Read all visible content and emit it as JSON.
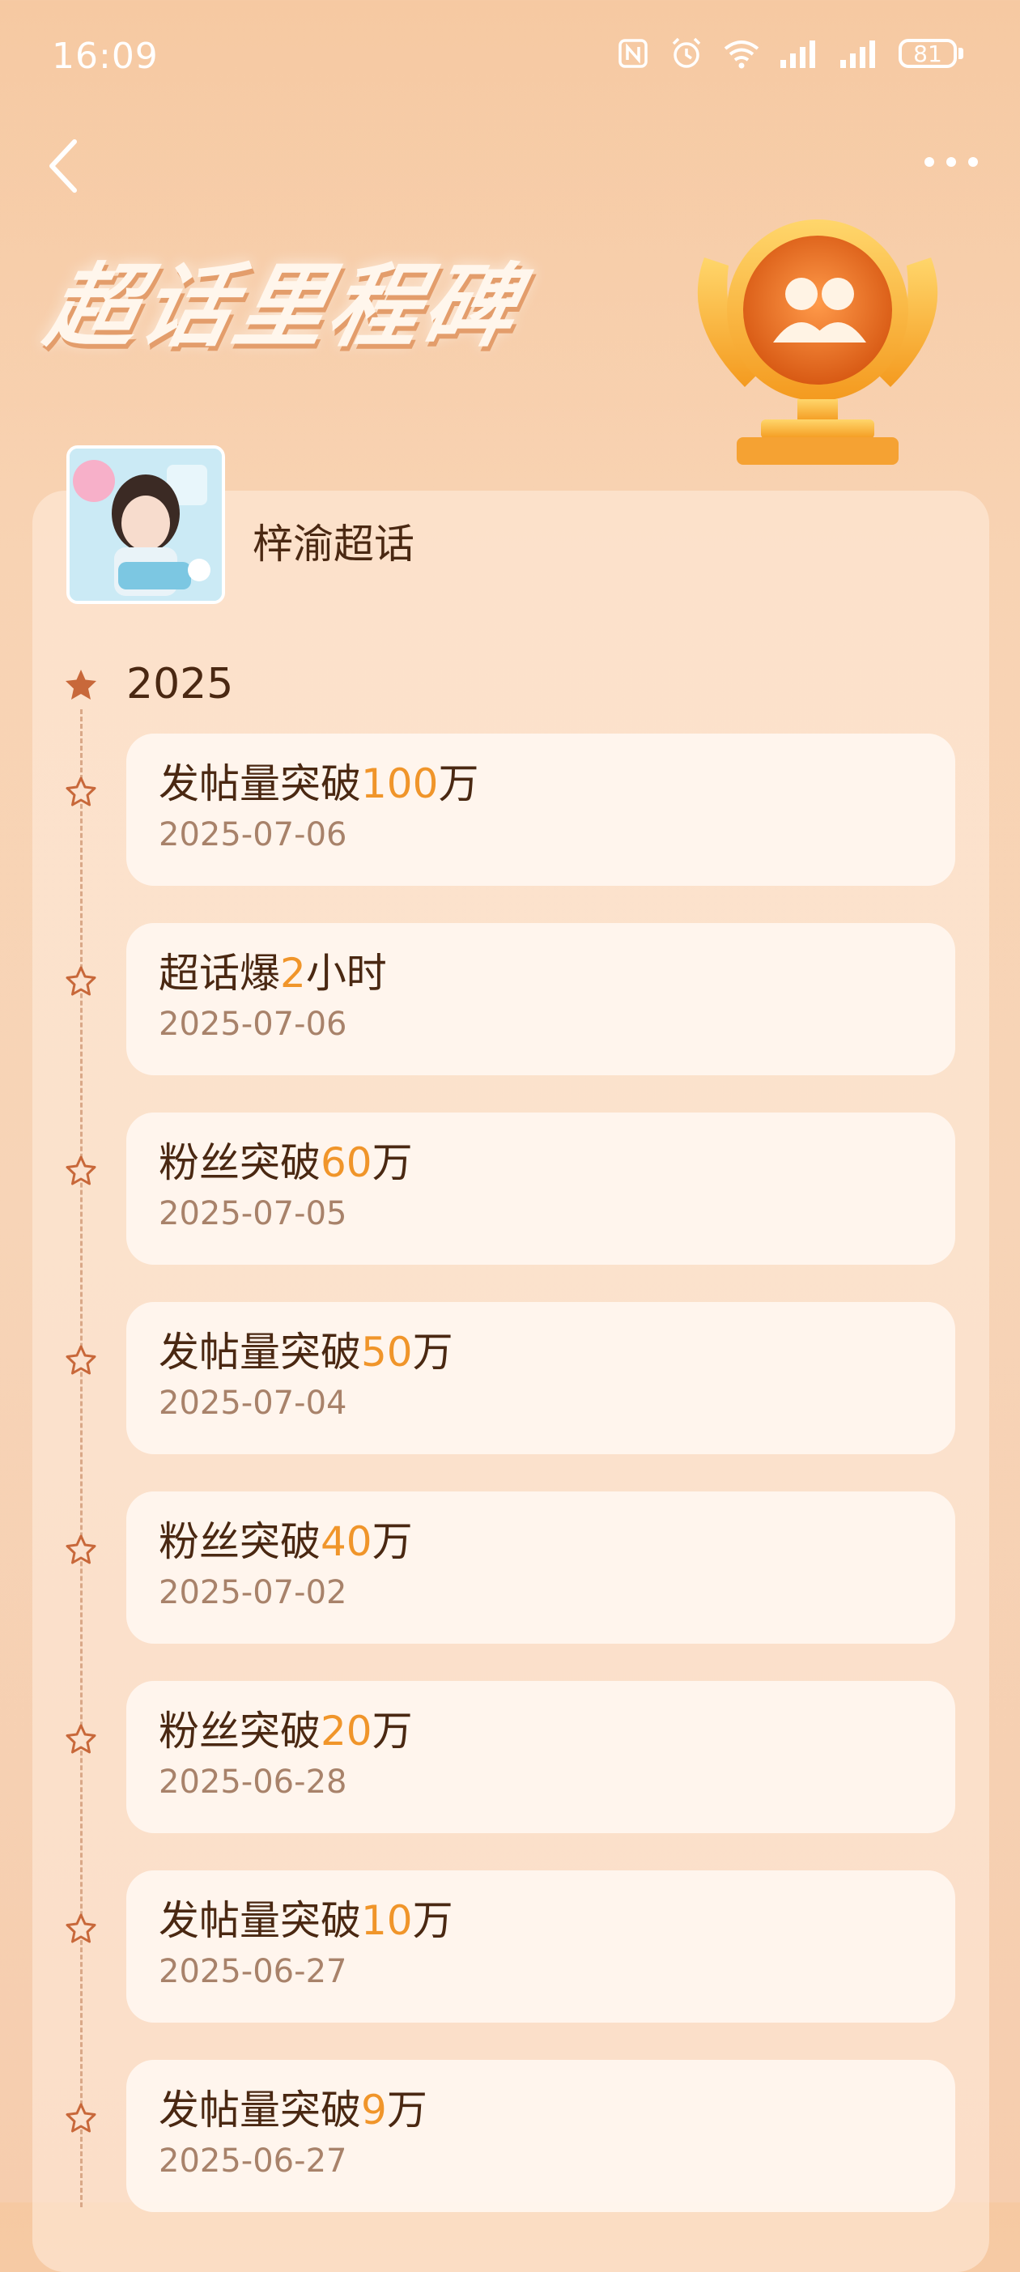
{
  "status_bar": {
    "time": "16:09",
    "battery": "81",
    "icons": [
      "nfc-icon",
      "alarm-icon",
      "wifi-icon",
      "signal-icon",
      "signal-icon",
      "battery-icon"
    ]
  },
  "nav": {
    "back_icon": "chevron-left-icon",
    "more_icon": "more-dots-icon"
  },
  "banner": {
    "title": "超话里程碑",
    "trophy_icon": "trophy-icon"
  },
  "topic": {
    "name": "梓渝超话"
  },
  "colors": {
    "accent": "#f0952a",
    "text": "#4a2812",
    "date": "#a8826a",
    "background": "#f7d3b4"
  },
  "timeline": {
    "year": "2025",
    "items": [
      {
        "pre": "发帖量突破",
        "num": "100",
        "post": "万",
        "date": "2025-07-06"
      },
      {
        "pre": "超话爆",
        "num": "2",
        "post": "小时",
        "date": "2025-07-06"
      },
      {
        "pre": "粉丝突破",
        "num": "60",
        "post": "万",
        "date": "2025-07-05"
      },
      {
        "pre": "发帖量突破",
        "num": "50",
        "post": "万",
        "date": "2025-07-04"
      },
      {
        "pre": "粉丝突破",
        "num": "40",
        "post": "万",
        "date": "2025-07-02"
      },
      {
        "pre": "粉丝突破",
        "num": "20",
        "post": "万",
        "date": "2025-06-28"
      },
      {
        "pre": "发帖量突破",
        "num": "10",
        "post": "万",
        "date": "2025-06-27"
      },
      {
        "pre": "发帖量突破",
        "num": "9",
        "post": "万",
        "date": "2025-06-27"
      }
    ]
  }
}
